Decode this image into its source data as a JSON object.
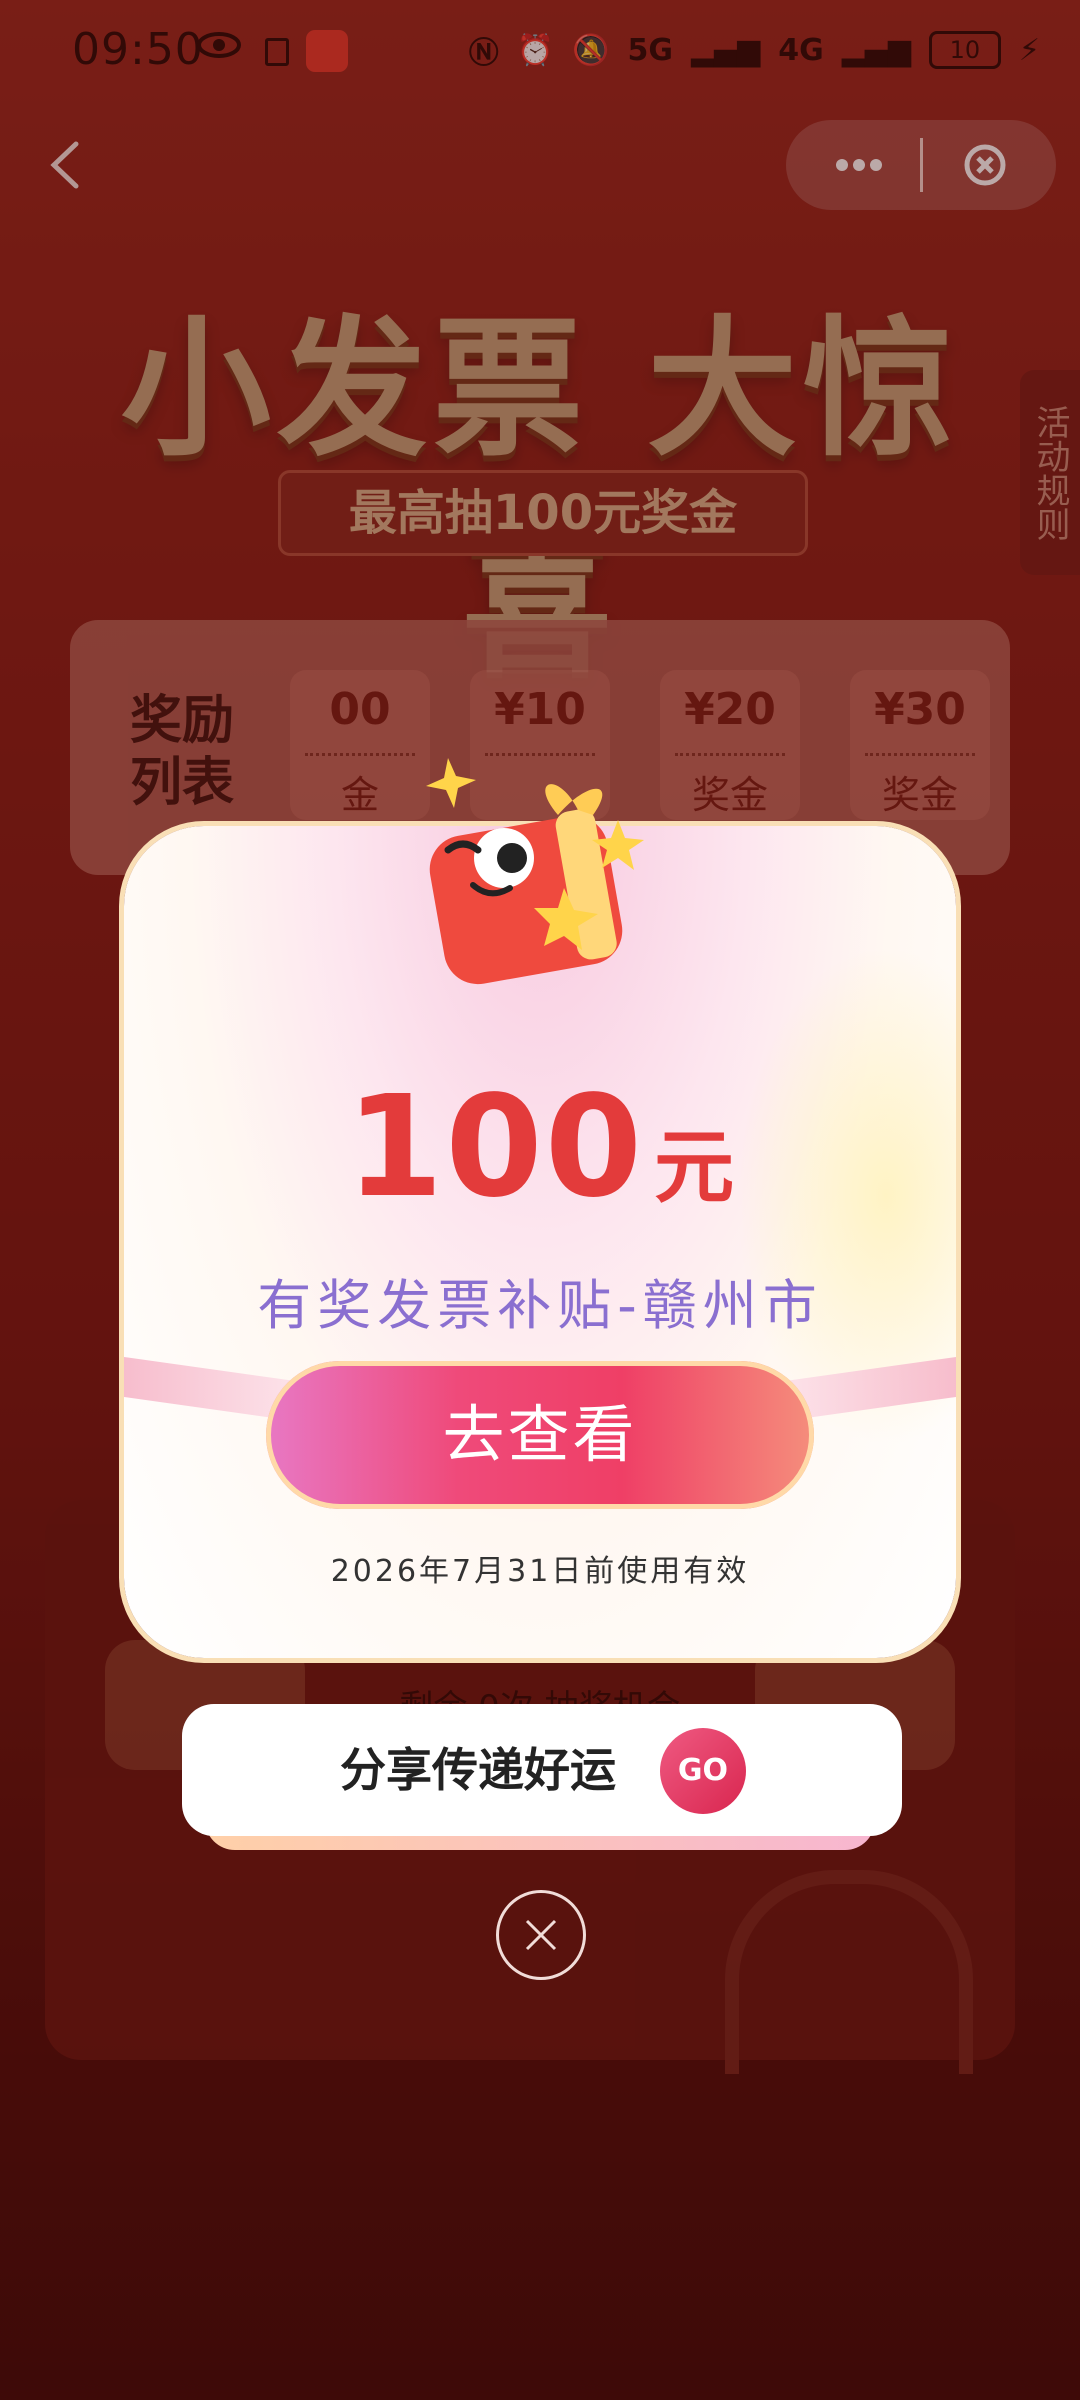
{
  "status_bar": {
    "time": "09:50",
    "signal_5g": "5G",
    "signal_4g": "4G",
    "battery": "10"
  },
  "nav": {
    "back_icon": "chevron-left-icon",
    "more_icon": "more-dots-icon",
    "close_icon": "close-circle-icon"
  },
  "hero": {
    "title": "小发票 大惊喜",
    "subtitle": "最高抽100元奖金"
  },
  "rules_tab": "活动规则",
  "reward_list": {
    "label": "奖励列表",
    "chips": [
      {
        "amount": "00",
        "unit": "金"
      },
      {
        "amount": "¥10",
        "unit": ""
      },
      {
        "amount": "¥20",
        "unit": "奖金"
      },
      {
        "amount": "¥30",
        "unit": "奖金"
      }
    ]
  },
  "behind_text": "剩余 0次 抽奖机会",
  "prize_card": {
    "amount": "100",
    "currency": "元",
    "name": "有奖发票补贴-赣州市",
    "view_button": "去查看",
    "validity": "2026年7月31日前使用有效",
    "accent_color": "#e33b3b"
  },
  "share": {
    "label": "分享传递好运",
    "go_button": "GO"
  },
  "close_popup_icon": "close-icon"
}
